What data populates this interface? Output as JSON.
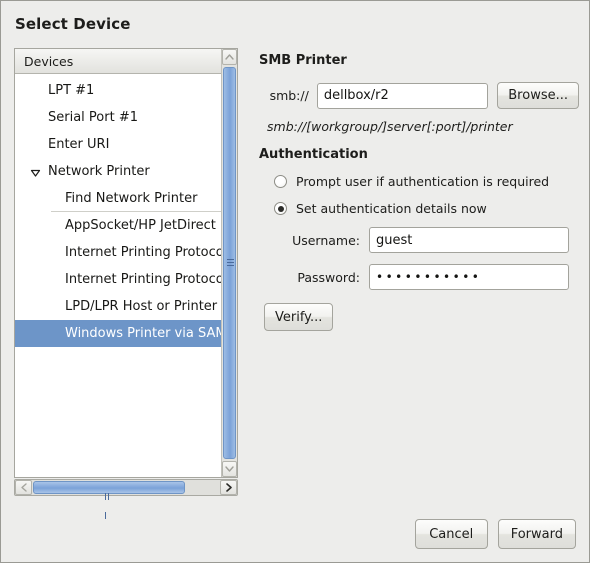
{
  "window": {
    "title": "Select Device",
    "accent_selection": "#6d95c8",
    "background": "#ededeb"
  },
  "device_list": {
    "column_header": "Devices",
    "items": [
      {
        "label": "LPT #1",
        "level": 0,
        "expander": "none",
        "selected": false,
        "separator_above": false
      },
      {
        "label": "Serial Port #1",
        "level": 0,
        "expander": "none",
        "selected": false,
        "separator_above": false
      },
      {
        "label": "Enter URI",
        "level": 0,
        "expander": "none",
        "selected": false,
        "separator_above": false
      },
      {
        "label": "Network Printer",
        "level": 0,
        "expander": "expanded",
        "selected": false,
        "separator_above": false
      },
      {
        "label": "Find Network Printer",
        "level": 1,
        "expander": "none",
        "selected": false,
        "separator_above": false
      },
      {
        "label": "AppSocket/HP JetDirect",
        "level": 1,
        "expander": "none",
        "selected": false,
        "separator_above": true
      },
      {
        "label": "Internet Printing Protocol",
        "level": 1,
        "expander": "none",
        "selected": false,
        "separator_above": false
      },
      {
        "label": "Internet Printing Protocol",
        "level": 1,
        "expander": "none",
        "selected": false,
        "separator_above": false
      },
      {
        "label": "LPD/LPR Host or Printer",
        "level": 1,
        "expander": "none",
        "selected": false,
        "separator_above": false
      },
      {
        "label": "Windows Printer via SAMBA",
        "level": 1,
        "expander": "none",
        "selected": true,
        "separator_above": false
      }
    ],
    "vertical_scrollbar": {
      "up_icon": "chevron-up-icon",
      "down_icon": "chevron-down-icon"
    },
    "horizontal_scrollbar": {
      "left_icon": "chevron-left-icon",
      "right_icon": "chevron-right-icon"
    }
  },
  "smb": {
    "section_title": "SMB Printer",
    "prefix_label": "smb://",
    "uri_value": "dellbox/r2",
    "uri_placeholder": "",
    "browse_label": "Browse...",
    "hint": "smb://[workgroup/]server[:port]/printer"
  },
  "authentication": {
    "section_title": "Authentication",
    "options": [
      {
        "label": "Prompt user if authentication is required",
        "selected": false
      },
      {
        "label": "Set authentication details now",
        "selected": true
      }
    ],
    "username_label": "Username:",
    "username_value": "guest",
    "password_label": "Password:",
    "password_masked": "•••••••••••",
    "verify_label": "Verify..."
  },
  "footer": {
    "cancel_label": "Cancel",
    "forward_label": "Forward"
  }
}
